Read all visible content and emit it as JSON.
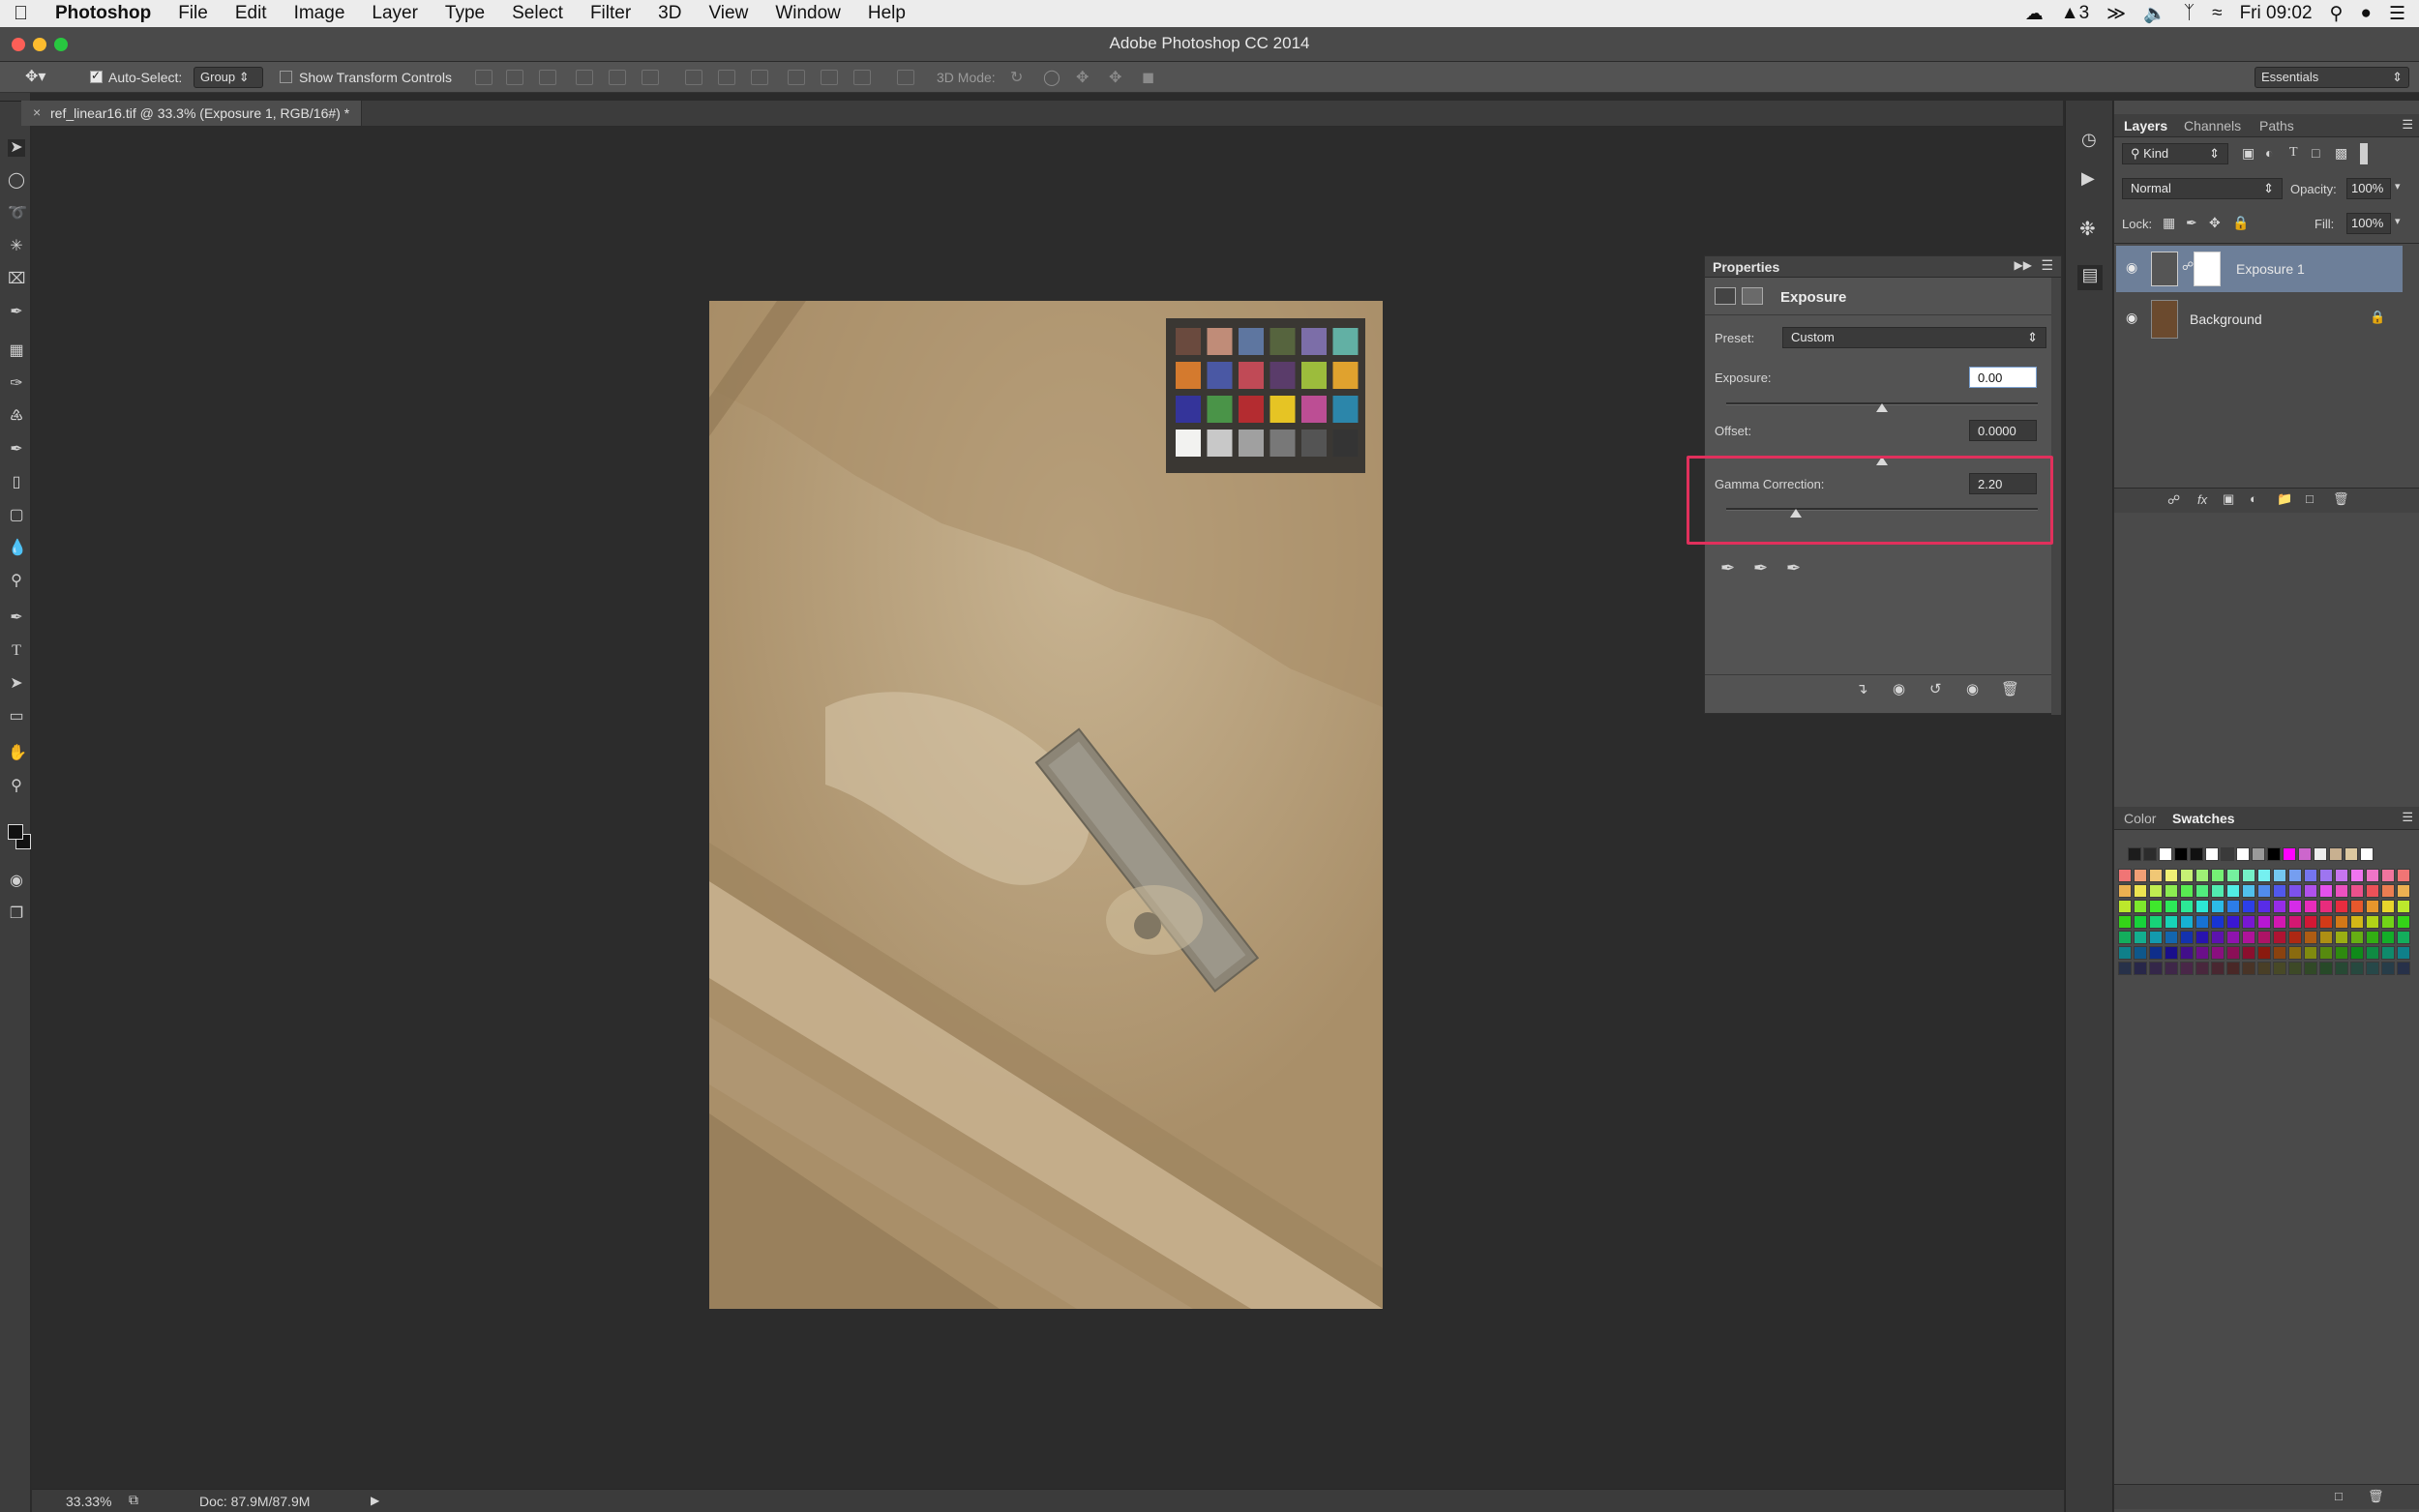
{
  "menubar": {
    "app": "Photoshop",
    "items": [
      "File",
      "Edit",
      "Image",
      "Layer",
      "Type",
      "Select",
      "Filter",
      "3D",
      "View",
      "Window",
      "Help"
    ],
    "badge": "3",
    "clock": "Fri 09:02"
  },
  "window": {
    "title": "Adobe Photoshop CC 2014"
  },
  "options": {
    "auto_select_label": "Auto-Select:",
    "auto_select_value": "Group",
    "show_transform_label": "Show Transform Controls",
    "mode_3d_label": "3D Mode:",
    "workspace": "Essentials"
  },
  "document": {
    "tab_title": "ref_linear16.tif @ 33.3% (Exposure 1, RGB/16#) *",
    "zoom": "33.33%",
    "doc_size": "Doc: 87.9M/87.9M"
  },
  "properties": {
    "title": "Properties",
    "adjustment": "Exposure",
    "preset_label": "Preset:",
    "preset_value": "Custom",
    "exposure_label": "Exposure:",
    "exposure_value": "0.00",
    "offset_label": "Offset:",
    "offset_value": "0.0000",
    "gamma_label": "Gamma Correction:",
    "gamma_value": "2.20"
  },
  "layers_panel": {
    "tabs": [
      "Layers",
      "Channels",
      "Paths"
    ],
    "filter": "Kind",
    "blend_mode": "Normal",
    "opacity_label": "Opacity:",
    "opacity_value": "100%",
    "lock_label": "Lock:",
    "fill_label": "Fill:",
    "fill_value": "100%",
    "layers": [
      {
        "name": "Exposure 1",
        "selected": true
      },
      {
        "name": "Background",
        "selected": false
      }
    ]
  },
  "color_panel": {
    "tabs": [
      "Color",
      "Swatches"
    ]
  },
  "colors": {
    "highlight": "#e1305c",
    "selected_layer": "#6d7f99",
    "image_base": "#b9a17d"
  }
}
